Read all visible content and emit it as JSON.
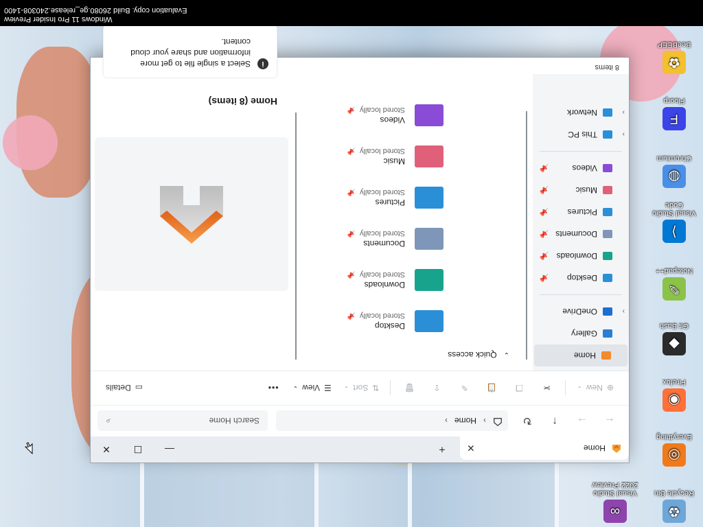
{
  "system": {
    "watermark_line1": "Windows 11 Pro Insider Preview",
    "watermark_line2": "Evaluation copy. Build 26080.ge_release.240308-1400"
  },
  "desktop_icons": [
    {
      "label": "Recycle Bin",
      "icon": "recycle-bin-icon",
      "color": "#6ea6d8"
    },
    {
      "label": "Everything",
      "icon": "everything-icon",
      "color": "#f07a1a"
    },
    {
      "label": "Firefox",
      "icon": "firefox-icon",
      "color": "#ff7139"
    },
    {
      "label": "Git Bash",
      "icon": "git-bash-icon",
      "color": "#2b2b2b"
    },
    {
      "label": "Notepad++",
      "icon": "notepad-plus-plus-icon",
      "color": "#8bc34a"
    },
    {
      "label": "Visual Studio Code",
      "icon": "vscode-icon",
      "color": "#0078d4"
    },
    {
      "label": "Chromium",
      "icon": "chromium-icon",
      "color": "#4a8fe7"
    },
    {
      "label": "Floorp",
      "icon": "floorp-icon",
      "color": "#3b44e8"
    },
    {
      "label": "BeeBEEP",
      "icon": "beebeep-icon",
      "color": "#f3c030"
    },
    {
      "label": "Visual Studio 2022 Preview",
      "icon": "visual-studio-icon",
      "color": "#8e44ad"
    }
  ],
  "window": {
    "tab_title": "Home",
    "new_tab_symbol": "+",
    "breadcrumb": [
      "Home"
    ],
    "search_placeholder": "Search Home",
    "commands": {
      "new": "New",
      "sort": "Sort",
      "view": "View",
      "more": "•••",
      "details": "Details"
    },
    "nav": {
      "items": [
        {
          "label": "Home",
          "icon": "home-icon",
          "selected": true
        },
        {
          "label": "Gallery",
          "icon": "gallery-icon"
        },
        {
          "label": "OneDrive",
          "icon": "onedrive-icon",
          "expandable": true
        }
      ],
      "pinned": [
        {
          "label": "Desktop",
          "icon": "desktop-folder-icon"
        },
        {
          "label": "Downloads",
          "icon": "downloads-icon"
        },
        {
          "label": "Documents",
          "icon": "documents-icon"
        },
        {
          "label": "Pictures",
          "icon": "pictures-icon"
        },
        {
          "label": "Music",
          "icon": "music-icon"
        },
        {
          "label": "Videos",
          "icon": "videos-icon"
        }
      ],
      "locations": [
        {
          "label": "This PC",
          "icon": "this-pc-icon"
        },
        {
          "label": "Network",
          "icon": "network-icon"
        }
      ]
    },
    "quick_access": {
      "header": "Quick access",
      "items": [
        {
          "name": "Desktop",
          "status": "Stored locally",
          "icon": "desktop-folder-icon",
          "color": "#2b8fd8"
        },
        {
          "name": "Downloads",
          "status": "Stored locally",
          "icon": "downloads-folder-icon",
          "color": "#18a48c"
        },
        {
          "name": "Documents",
          "status": "Stored locally",
          "icon": "documents-folder-icon",
          "color": "#7e97b8"
        },
        {
          "name": "Pictures",
          "status": "Stored locally",
          "icon": "pictures-folder-icon",
          "color": "#2a8fd6"
        },
        {
          "name": "Music",
          "status": "Stored locally",
          "icon": "music-folder-icon",
          "color": "#e0607a"
        },
        {
          "name": "Videos",
          "status": "Stored locally",
          "icon": "videos-folder-icon",
          "color": "#8a4bd6"
        }
      ]
    },
    "details": {
      "title": "Home (8 items)",
      "info": "Select a single file to get more information and share your cloud content."
    },
    "status": "8 items"
  }
}
